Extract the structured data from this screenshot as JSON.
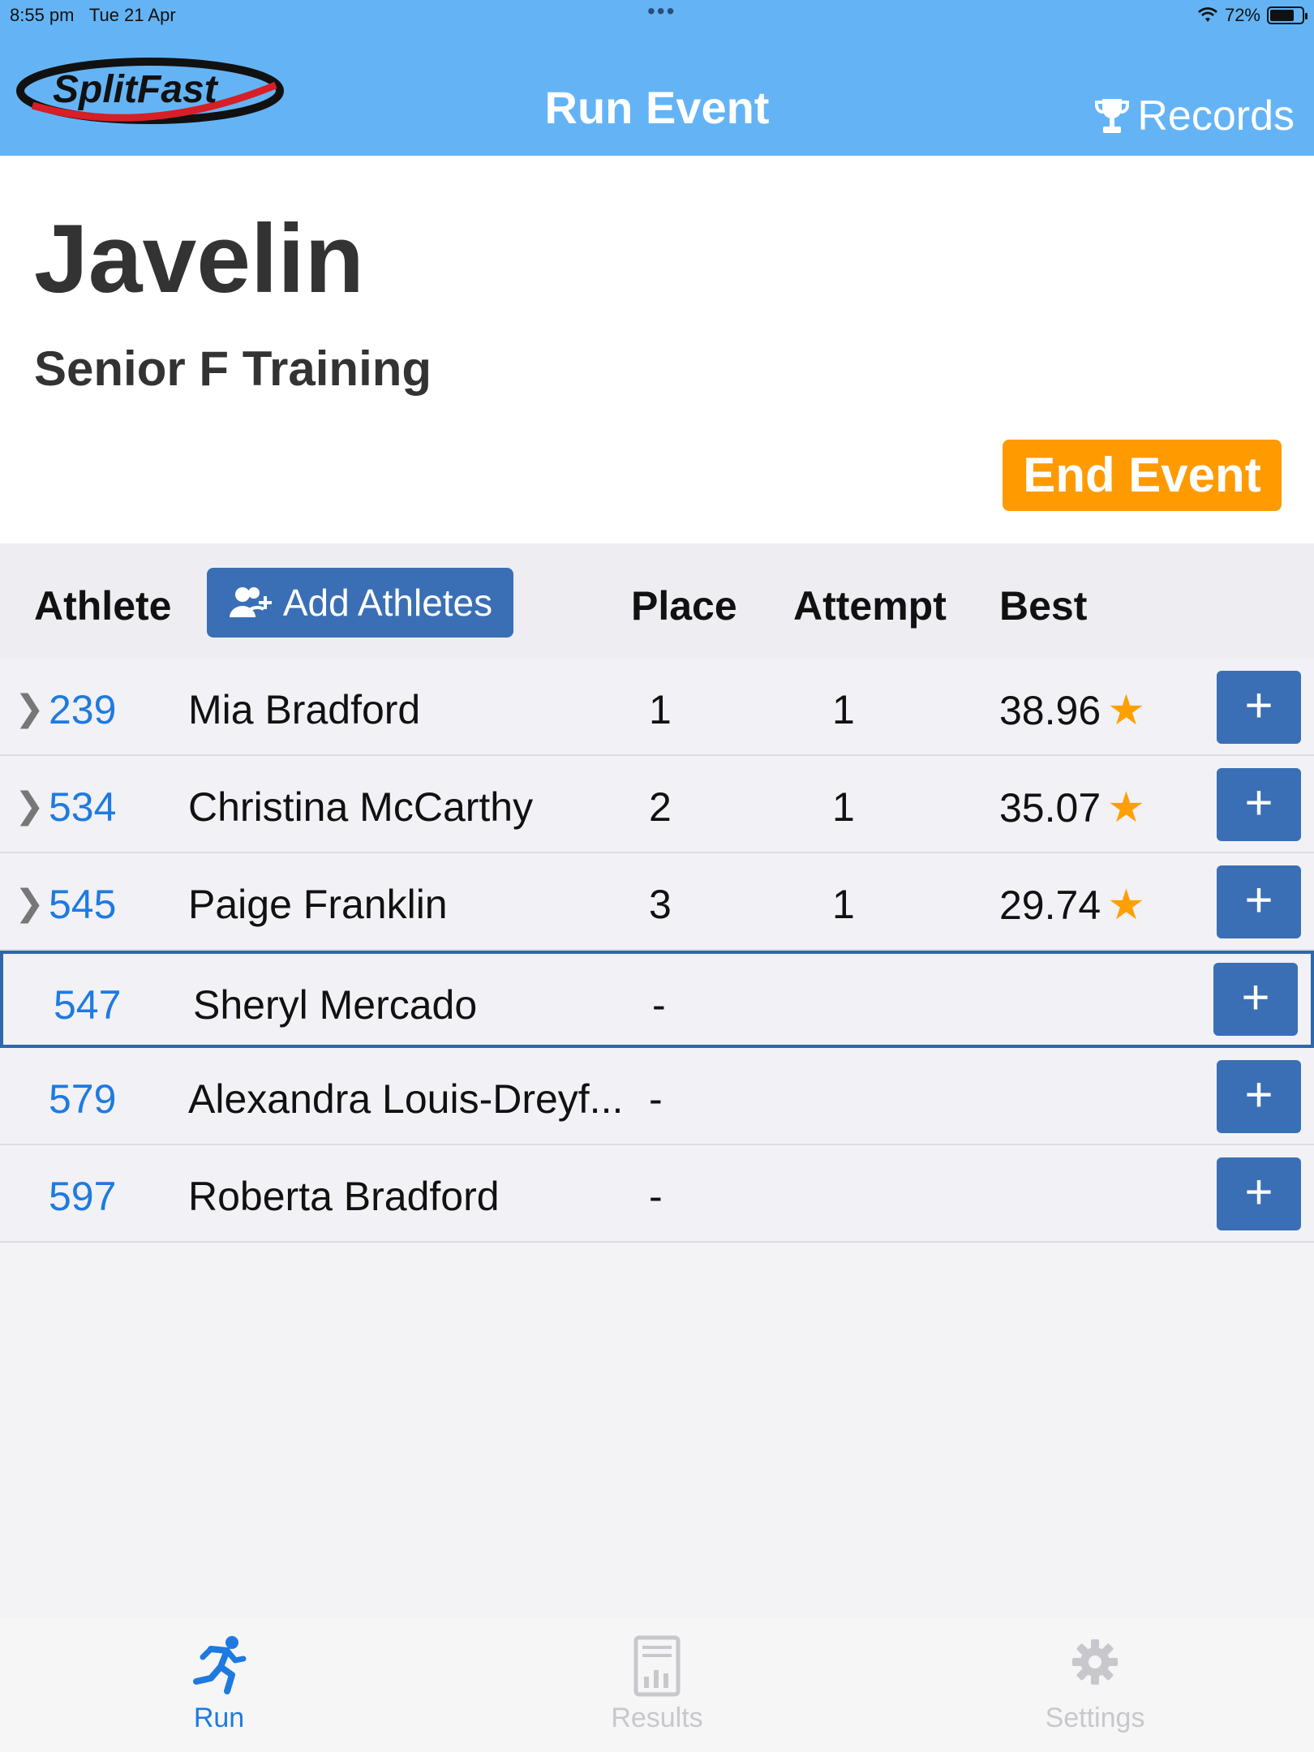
{
  "status_bar": {
    "time": "8:55 pm",
    "date": "Tue 21 Apr",
    "battery": "72%"
  },
  "header": {
    "logo_text": "SplitFast",
    "title": "Run Event",
    "records_label": "Records"
  },
  "event": {
    "name": "Javelin",
    "group": "Senior F Training",
    "end_label": "End Event"
  },
  "table": {
    "columns": {
      "athlete": "Athlete",
      "place": "Place",
      "attempt": "Attempt",
      "best": "Best"
    },
    "add_athletes_label": "Add Athletes",
    "rows": [
      {
        "number": "239",
        "name": "Mia Bradford",
        "place": "1",
        "attempt": "1",
        "best": "38.96",
        "has_star": true
      },
      {
        "number": "534",
        "name": "Christina McCarthy",
        "place": "2",
        "attempt": "1",
        "best": "35.07",
        "has_star": true
      },
      {
        "number": "545",
        "name": "Paige Franklin",
        "place": "3",
        "attempt": "1",
        "best": "29.74",
        "has_star": true
      },
      {
        "number": "547",
        "name": "Sheryl Mercado",
        "place": "-",
        "attempt": "",
        "best": "",
        "has_star": false
      },
      {
        "number": "579",
        "name": "Alexandra Louis-Dreyf...",
        "place": "-",
        "attempt": "",
        "best": "",
        "has_star": false
      },
      {
        "number": "597",
        "name": "Roberta Bradford",
        "place": "-",
        "attempt": "",
        "best": "",
        "has_star": false
      }
    ],
    "selected_index": 3
  },
  "tabs": [
    {
      "label": "Run",
      "icon": "runner-icon",
      "active": true
    },
    {
      "label": "Results",
      "icon": "results-icon",
      "active": false
    },
    {
      "label": "Settings",
      "icon": "gear-icon",
      "active": false
    }
  ],
  "colors": {
    "header_bg": "#64b4f5",
    "accent_blue": "#3a6fb5",
    "link_blue": "#1f7ae0",
    "end_orange": "#ff9a00",
    "star": "#ff9f00"
  }
}
